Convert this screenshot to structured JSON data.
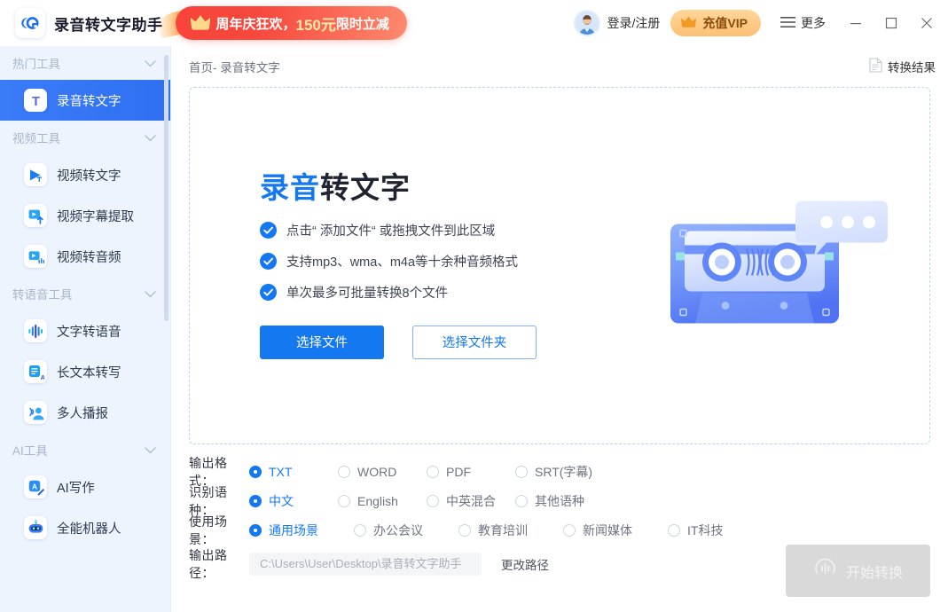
{
  "titlebar": {
    "logo_icon": "app-logo-icon",
    "app_title": "录音转文字助手",
    "promo": {
      "crown_icon": "crown-icon",
      "text_before": "周年庆狂欢，",
      "amount": "150元",
      "text_after": "限时立减"
    },
    "avatar_icon": "user-avatar",
    "login_label": "登录/注册",
    "vip": {
      "icon": "crown-icon",
      "label": "充值VIP"
    },
    "more": {
      "icon": "hamburger-icon",
      "label": "更多"
    },
    "window_controls": {
      "minimize_icon": "minimize-icon",
      "maximize_icon": "maximize-icon",
      "close_icon": "close-icon"
    }
  },
  "sidebar": {
    "groups": [
      {
        "title": "热门工具",
        "chevron_icon": "chevron-down-icon",
        "items": [
          {
            "label": "录音转文字",
            "icon": "audio-to-text-icon",
            "active": true
          }
        ]
      },
      {
        "title": "视频工具",
        "chevron_icon": "chevron-down-icon",
        "items": [
          {
            "label": "视频转文字",
            "icon": "video-to-text-icon",
            "active": false
          },
          {
            "label": "视频字幕提取",
            "icon": "video-subtitle-extract-icon",
            "active": false
          },
          {
            "label": "视频转音频",
            "icon": "video-to-audio-icon",
            "active": false
          }
        ]
      },
      {
        "title": "转语音工具",
        "chevron_icon": "chevron-down-icon",
        "items": [
          {
            "label": "文字转语音",
            "icon": "text-to-speech-icon",
            "active": false
          },
          {
            "label": "长文本转写",
            "icon": "long-text-transcribe-icon",
            "active": false
          },
          {
            "label": "多人播报",
            "icon": "multi-speaker-icon",
            "active": false
          }
        ]
      },
      {
        "title": "AI工具",
        "chevron_icon": "chevron-down-icon",
        "items": [
          {
            "label": "AI写作",
            "icon": "ai-writing-icon",
            "active": false
          },
          {
            "label": "全能机器人",
            "icon": "robot-icon",
            "active": false
          }
        ]
      }
    ]
  },
  "main": {
    "breadcrumb": "首页- 录音转文字",
    "result_button": {
      "icon": "document-icon",
      "label": "转换结果"
    },
    "hero": {
      "title_accent": "录音",
      "title_rest": "转文字",
      "features": [
        "点击“ 添加文件“  或拖拽文件到此区域",
        "支持mp3、wma、m4a等十余种音频格式",
        "单次最多可批量转换8个文件"
      ],
      "check_icon": "check-circle-icon",
      "illustration_icon": "cassette-tape-icon",
      "buttons": {
        "select_file": "选择文件",
        "select_folder": "选择文件夹"
      }
    },
    "options": {
      "output_format": {
        "label": "输出格式：",
        "selected": "TXT",
        "choices": [
          "TXT",
          "WORD",
          "PDF",
          "SRT(字幕)"
        ]
      },
      "language": {
        "label": "识别语种：",
        "selected": "中文",
        "choices": [
          "中文",
          "English",
          "中英混合",
          "其他语种"
        ]
      },
      "scenario": {
        "label": "使用场景：",
        "selected": "通用场景",
        "choices": [
          "通用场景",
          "办公会议",
          "教育培训",
          "新闻媒体",
          "IT科技"
        ]
      },
      "output_path": {
        "label": "输出路径：",
        "value": "C:\\Users\\User\\Desktop\\录音转文字助手",
        "change_label": "更改路径"
      }
    },
    "start_button": {
      "icon": "waveform-circle-icon",
      "label": "开始转换",
      "enabled": false
    }
  },
  "colors": {
    "accent": "#1478f0",
    "sidebar_bg": "#eef4fd",
    "promo_red": "#f6483c",
    "vip_gold": "#fcc074",
    "disabled_gray": "#d9d9d9"
  }
}
